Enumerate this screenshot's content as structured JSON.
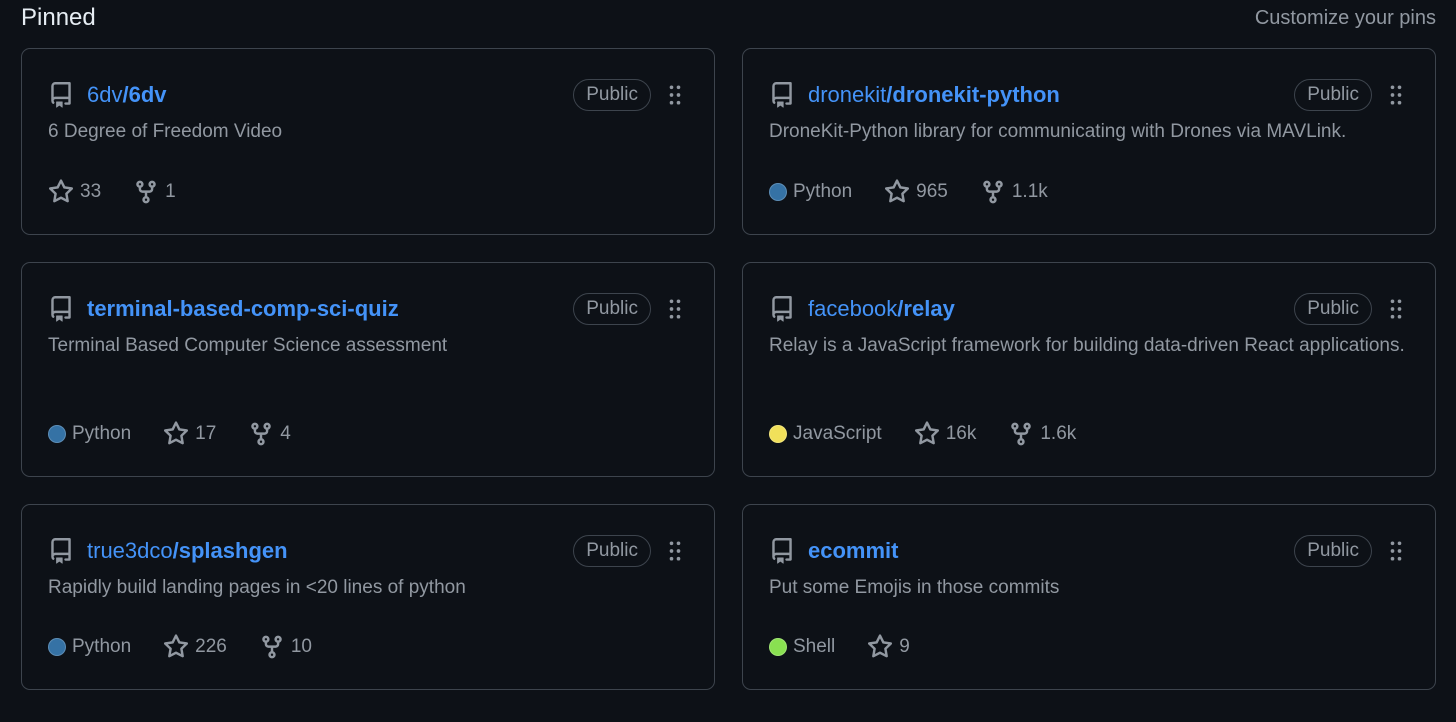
{
  "section": {
    "title": "Pinned",
    "customize_label": "Customize your pins"
  },
  "cards": [
    {
      "owner": "6dv",
      "separator": "/",
      "name": "6dv",
      "visibility": "Public",
      "description": "6 Degree of Freedom Video",
      "language": "",
      "language_color": "",
      "stars": "33",
      "forks": "1"
    },
    {
      "owner": "dronekit",
      "separator": "/",
      "name": "dronekit-python",
      "visibility": "Public",
      "description": "DroneKit-Python library for communicating with Drones via MAVLink.",
      "language": "Python",
      "language_color": "#3572A5",
      "stars": "965",
      "forks": "1.1k"
    },
    {
      "owner": "",
      "separator": "",
      "name": "terminal-based-comp-sci-quiz",
      "visibility": "Public",
      "description": "Terminal Based Computer Science assessment",
      "language": "Python",
      "language_color": "#3572A5",
      "stars": "17",
      "forks": "4"
    },
    {
      "owner": "facebook",
      "separator": "/",
      "name": "relay",
      "visibility": "Public",
      "description": "Relay is a JavaScript framework for building data-driven React applications.",
      "language": "JavaScript",
      "language_color": "#f1e05a",
      "stars": "16k",
      "forks": "1.6k"
    },
    {
      "owner": "true3dco",
      "separator": "/",
      "name": "splashgen",
      "visibility": "Public",
      "description": "Rapidly build landing pages in <20 lines of python",
      "language": "Python",
      "language_color": "#3572A5",
      "stars": "226",
      "forks": "10"
    },
    {
      "owner": "",
      "separator": "",
      "name": "ecommit",
      "visibility": "Public",
      "description": "Put some Emojis in those commits",
      "language": "Shell",
      "language_color": "#89e051",
      "stars": "9",
      "forks": ""
    }
  ],
  "icons": {
    "repo": "repo-icon",
    "drag": "grabber-icon",
    "star": "star-icon",
    "fork": "fork-icon"
  }
}
